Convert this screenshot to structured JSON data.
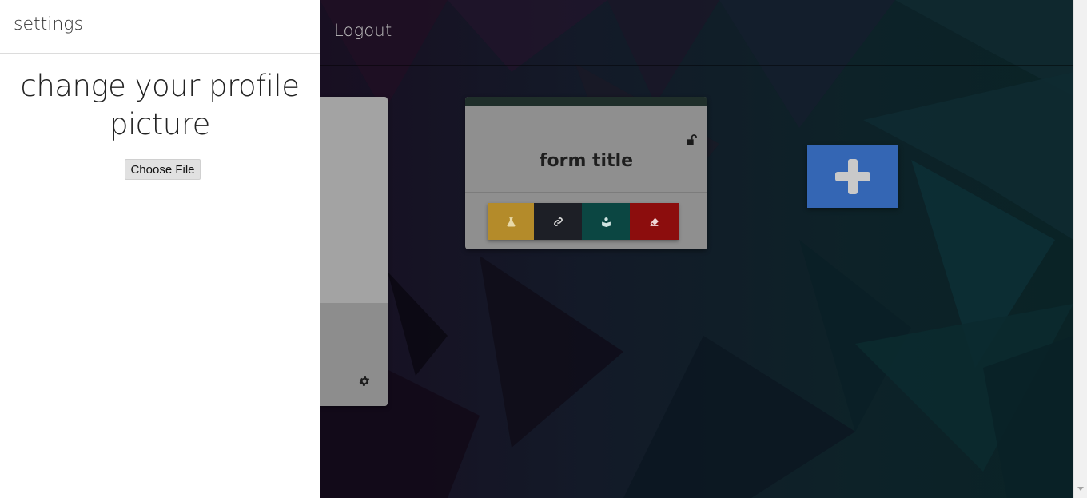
{
  "topbar": {
    "logout_label": "Logout"
  },
  "form_card": {
    "title": "form title"
  },
  "settings_panel": {
    "title": "settings",
    "heading": "change your profile picture",
    "file_button_label": "Choose File"
  },
  "colors": {
    "action_test": "#b48b2a",
    "action_link": "#1d1f26",
    "action_read": "#0b4642",
    "action_erase": "#8c0d0d",
    "add_button": "#3466b4"
  },
  "icons": {
    "card_lock": "lock-open-icon",
    "card_left_settings": "gear-icon",
    "action_test": "flask-icon",
    "action_link": "link-icon",
    "action_read": "reader-icon",
    "action_erase": "eraser-icon",
    "add": "plus-icon"
  }
}
